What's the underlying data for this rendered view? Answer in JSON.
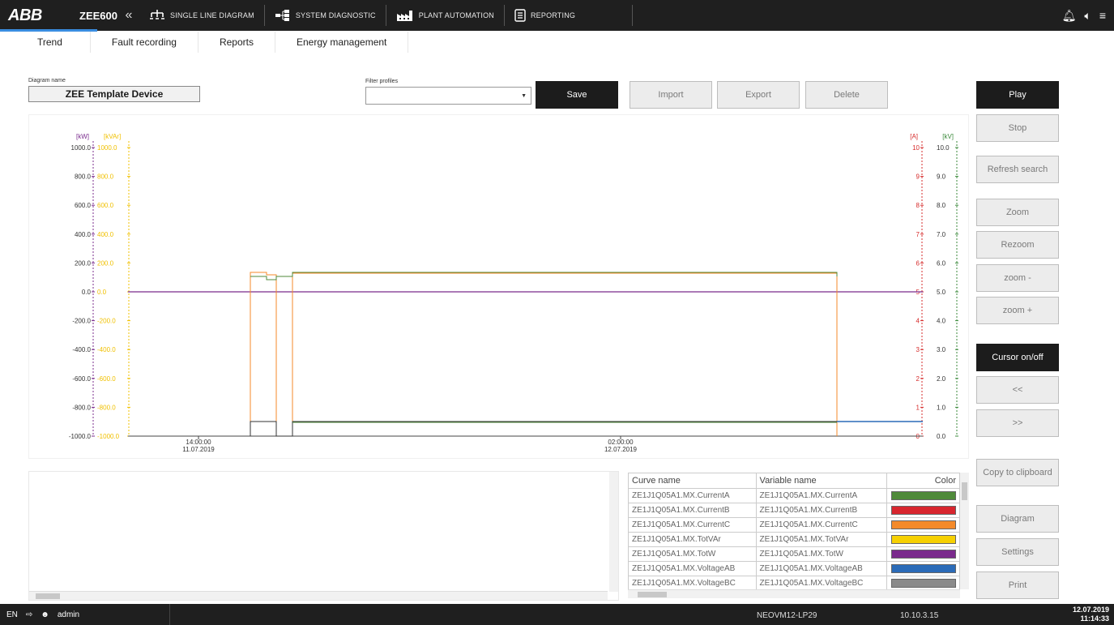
{
  "topbar": {
    "brand": "ABB",
    "app_name": "ZEE600",
    "nav": [
      {
        "label": "SINGLE LINE DIAGRAM",
        "icon": "single-line-diagram-icon"
      },
      {
        "label": "SYSTEM DIAGNOSTIC",
        "icon": "system-diagnostic-icon"
      },
      {
        "label": "PLANT AUTOMATION",
        "icon": "plant-automation-icon"
      },
      {
        "label": "REPORTING",
        "icon": "reporting-icon"
      }
    ]
  },
  "subtabs": [
    "Trend",
    "Fault recording",
    "Reports",
    "Energy management"
  ],
  "diagram": {
    "name_label": "Diagram name",
    "name_value": "ZEE Template Device"
  },
  "filter": {
    "label": "Filter profiles",
    "value": ""
  },
  "toolbar": {
    "save": "Save",
    "import": "Import",
    "export": "Export",
    "delete": "Delete"
  },
  "side_buttons": {
    "play": "Play",
    "stop": "Stop",
    "refresh": "Refresh search",
    "zoom": "Zoom",
    "rezoom": "Rezoom",
    "zoom_minus": "zoom -",
    "zoom_plus": "zoom +",
    "cursor": "Cursor on/off",
    "prev": "<<",
    "next": ">>",
    "copy": "Copy to clipboard",
    "diagram": "Diagram",
    "settings": "Settings",
    "print": "Print"
  },
  "chart_data": {
    "type": "line",
    "axes": {
      "left_kw": {
        "unit": "[kW]",
        "ticks": [
          "1000.0",
          "800.0",
          "600.0",
          "400.0",
          "200.0",
          "0.0",
          "-200.0",
          "-400.0",
          "-600.0",
          "-800.0",
          "-1000.0"
        ],
        "color": "#7b2d8e"
      },
      "left_kvar": {
        "unit": "[kVAr]",
        "ticks": [
          "1000.0",
          "800.0",
          "600.0",
          "400.0",
          "200.0",
          "0.0",
          "-200.0",
          "-400.0",
          "-600.0",
          "-800.0",
          "-1000.0"
        ],
        "color": "#f0c000"
      },
      "right_a": {
        "unit": "[A]",
        "ticks": [
          "10",
          "9",
          "8",
          "7",
          "6",
          "5",
          "4",
          "3",
          "2",
          "1",
          "0"
        ],
        "color": "#d62b2b"
      },
      "right_kv": {
        "unit": "[kV]",
        "ticks": [
          "10.0",
          "9.0",
          "8.0",
          "7.0",
          "6.0",
          "5.0",
          "4.0",
          "3.0",
          "2.0",
          "1.0",
          "0.0"
        ],
        "color": "#3b8a3b"
      }
    },
    "x_ticks": [
      {
        "time": "14:00:00",
        "date": "11.07.2019"
      },
      {
        "time": "02:00:00",
        "date": "12.07.2019"
      }
    ]
  },
  "legend": {
    "headers": [
      "Curve name",
      "Variable name",
      "Color"
    ],
    "rows": [
      {
        "curve": "ZE1J1Q05A1.MX.CurrentA",
        "variable": "ZE1J1Q05A1.MX.CurrentA",
        "color": "#4f8a3a"
      },
      {
        "curve": "ZE1J1Q05A1.MX.CurrentB",
        "variable": "ZE1J1Q05A1.MX.CurrentB",
        "color": "#d8262e"
      },
      {
        "curve": "ZE1J1Q05A1.MX.CurrentC",
        "variable": "ZE1J1Q05A1.MX.CurrentC",
        "color": "#f48a2a"
      },
      {
        "curve": "ZE1J1Q05A1.MX.TotVAr",
        "variable": "ZE1J1Q05A1.MX.TotVAr",
        "color": "#f6d000"
      },
      {
        "curve": "ZE1J1Q05A1.MX.TotW",
        "variable": "ZE1J1Q05A1.MX.TotW",
        "color": "#7a2a8c"
      },
      {
        "curve": "ZE1J1Q05A1.MX.VoltageAB",
        "variable": "ZE1J1Q05A1.MX.VoltageAB",
        "color": "#2b6bb8"
      },
      {
        "curve": "ZE1J1Q05A1.MX.VoltageBC",
        "variable": "ZE1J1Q05A1.MX.VoltageBC",
        "color": "#8a8a8a"
      }
    ]
  },
  "statusbar": {
    "lang": "EN",
    "user": "admin",
    "host": "NEOVM12-LP29",
    "ip": "10.10.3.15",
    "date": "12.07.2019",
    "time": "11:14:33"
  }
}
